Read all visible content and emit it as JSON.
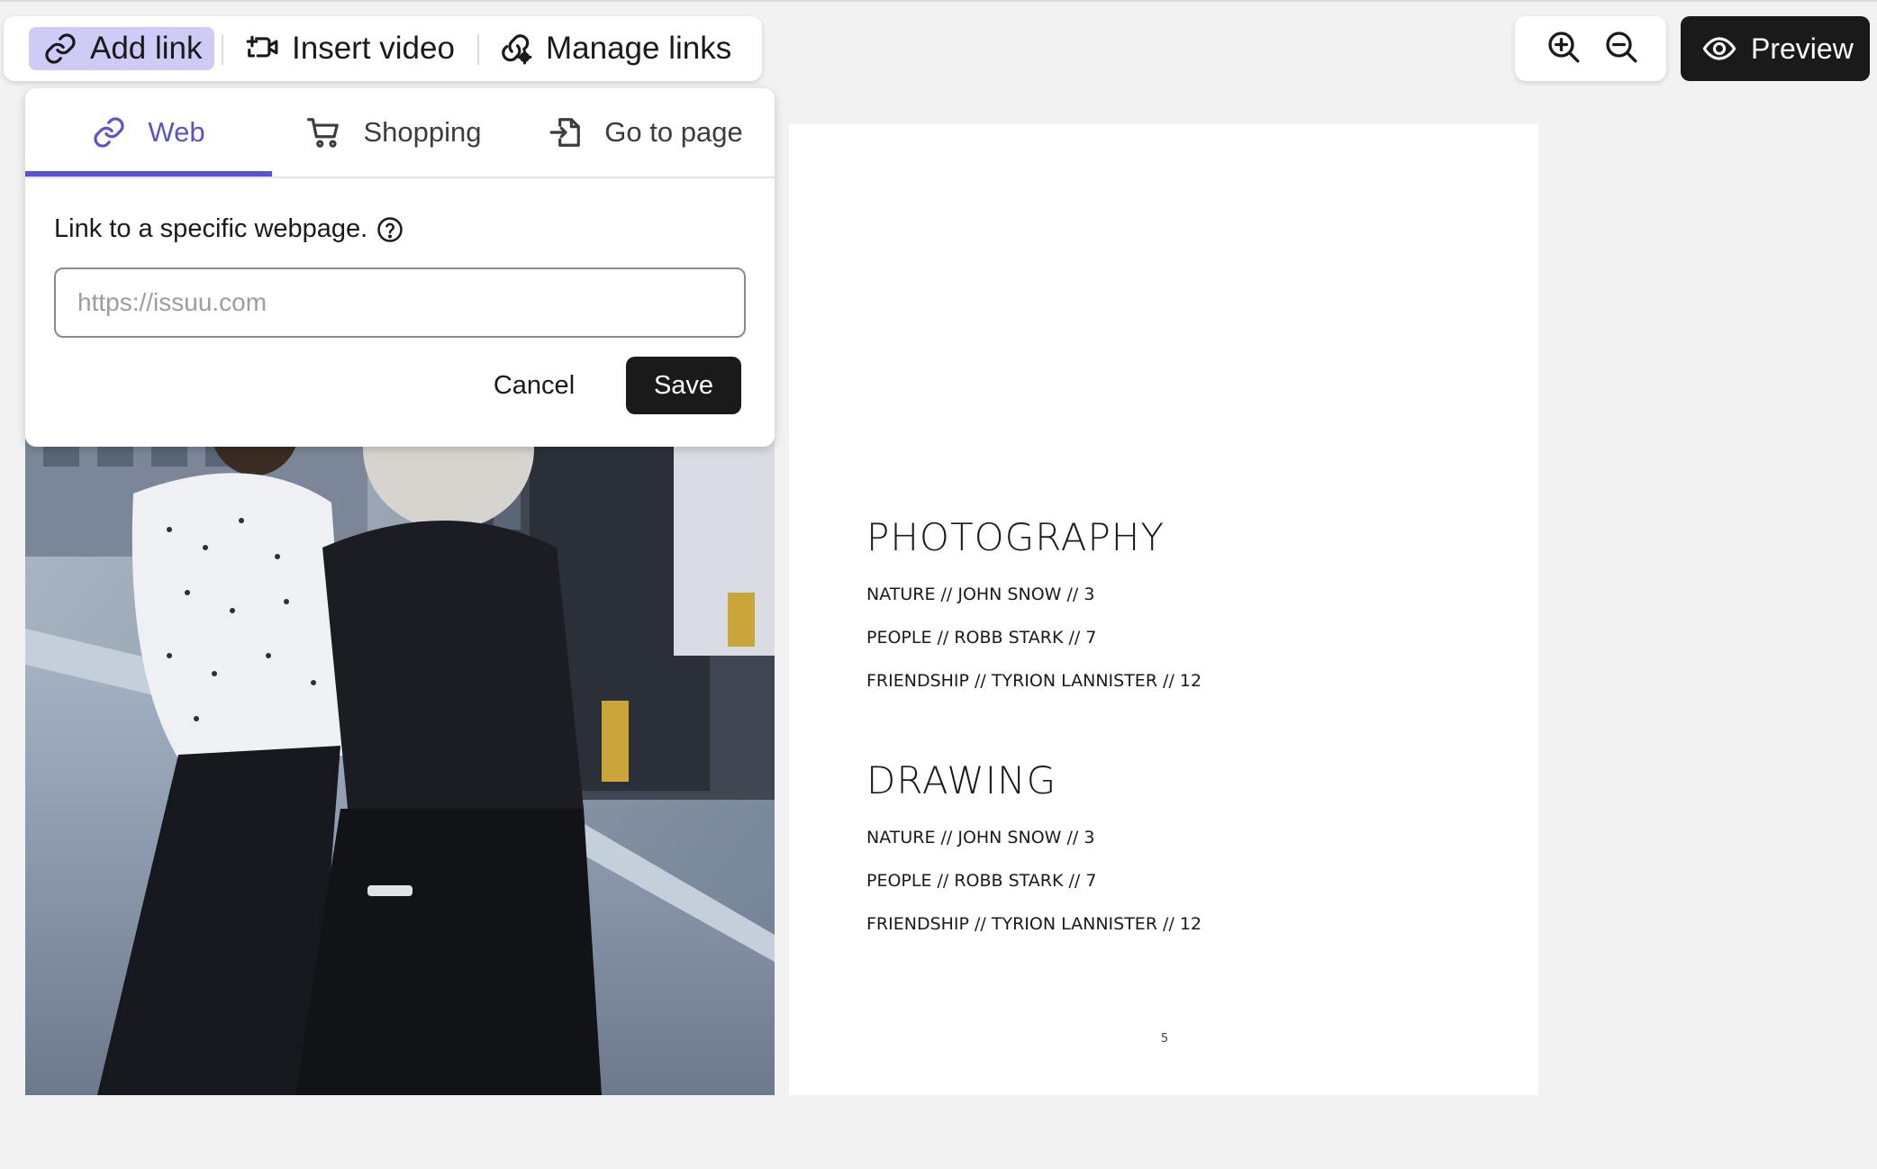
{
  "toolbar": {
    "add_link": {
      "label": "Add link",
      "icon": "link-icon"
    },
    "insert_video": {
      "label": "Insert video",
      "icon": "video-icon"
    },
    "manage_links": {
      "label": "Manage links",
      "icon": "link-settings-icon"
    }
  },
  "zoom": {
    "zoom_in_icon": "zoom-in-icon",
    "zoom_out_icon": "zoom-out-icon"
  },
  "preview": {
    "label": "Preview",
    "icon": "eye-icon"
  },
  "link_popup": {
    "tabs": [
      {
        "label": "Web",
        "icon": "link-icon",
        "active": true
      },
      {
        "label": "Shopping",
        "icon": "cart-icon",
        "active": false
      },
      {
        "label": "Go to page",
        "icon": "page-enter-icon",
        "active": false
      }
    ],
    "field_label": "Link to a specific webpage.",
    "help_icon": "help-circle-icon",
    "url_value": "",
    "url_placeholder": "https://issuu.com",
    "cancel_label": "Cancel",
    "save_label": "Save"
  },
  "page_right": {
    "sections": [
      {
        "title": "PHOTOGRAPHY",
        "items": [
          "NATURE // JOHN SNOW //  3",
          "PEOPLE // ROBB STARK //  7",
          "FRIENDSHIP // TYRION LANNISTER // 12"
        ]
      },
      {
        "title": "DRAWING",
        "items": [
          "NATURE // JOHN SNOW //  3",
          "PEOPLE // ROBB STARK //  7",
          "FRIENDSHIP // TYRION LANNISTER // 12"
        ]
      }
    ],
    "page_number": "5"
  },
  "colors": {
    "accent": "#5a53d0",
    "active_tool_bg": "#cfcbf7",
    "dark_button": "#1a1a1a",
    "canvas_bg": "#f2f2f2"
  }
}
